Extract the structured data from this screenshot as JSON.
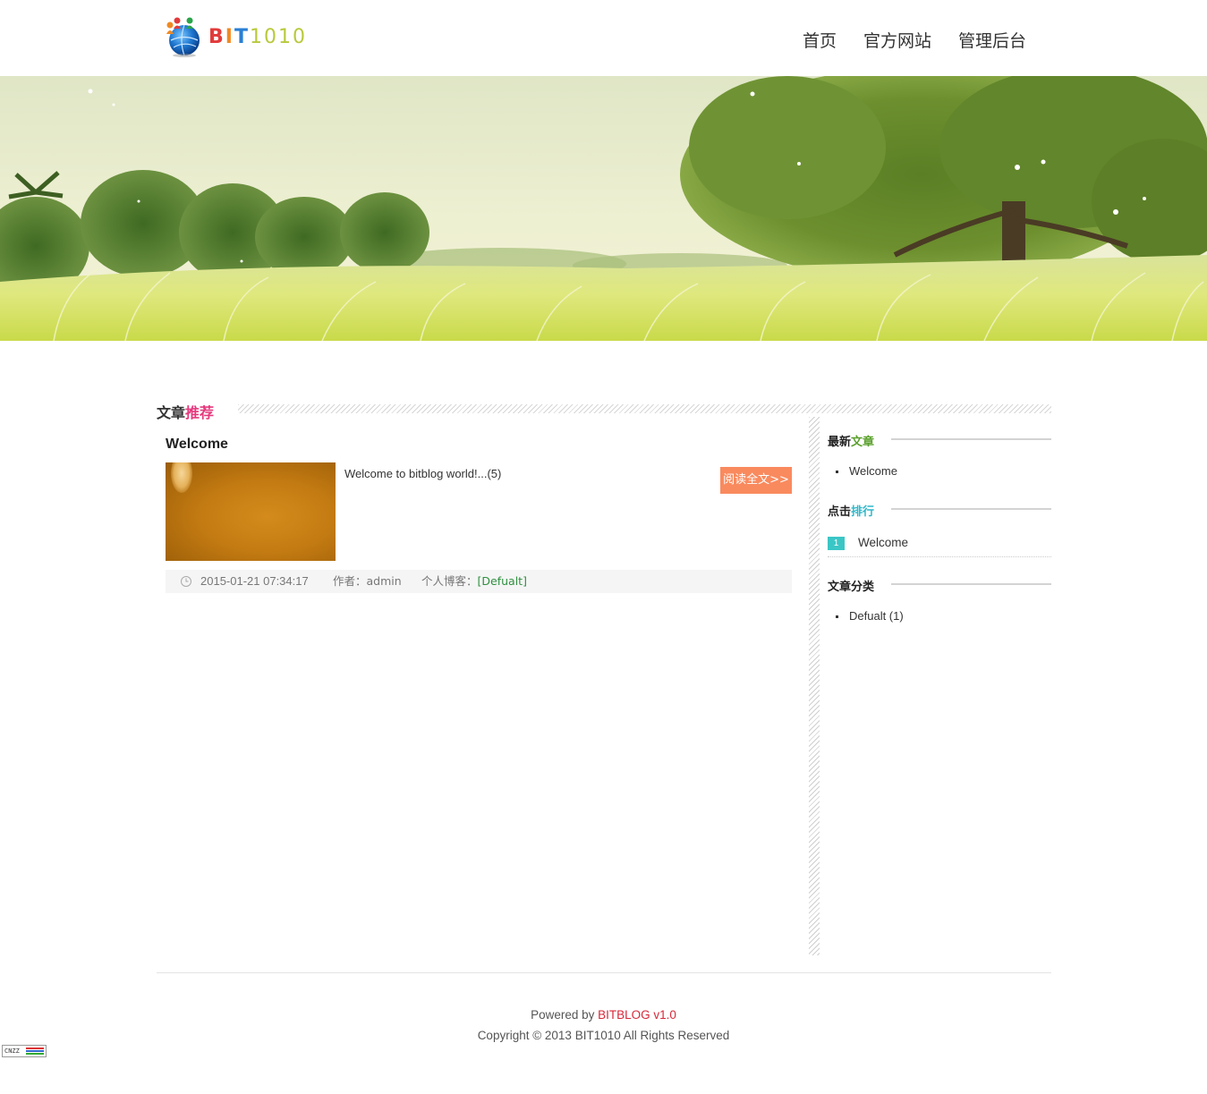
{
  "header": {
    "logo": {
      "brand_b": "B",
      "brand_i": "I",
      "brand_t": "T",
      "brand_num": "1010"
    },
    "nav": [
      {
        "label": "首页"
      },
      {
        "label": "官方网站"
      },
      {
        "label": "管理后台"
      }
    ]
  },
  "section": {
    "title_main": "文章",
    "title_highlight": "推荐",
    "highlight_color": "#e5397d"
  },
  "article": {
    "title": "Welcome",
    "summary": "Welcome to bitblog world!...(5)",
    "read_more": "阅读全文>>",
    "date": "2015-01-21 07:34:17",
    "author_label": "作者：admin",
    "blog_label": "个人博客：",
    "blog_category": "[Defualt]"
  },
  "sidebar": {
    "latest": {
      "title_main": "最新",
      "title_highlight": "文章",
      "highlight_color": "#5aa02c",
      "items": [
        "Welcome"
      ]
    },
    "ranking": {
      "title_main": "点击",
      "title_highlight": "排行",
      "highlight_color": "#2fb8c9",
      "items": [
        {
          "rank": "1",
          "title": "Welcome"
        }
      ]
    },
    "categories": {
      "title": "文章分类",
      "items": [
        "Defualt (1)"
      ]
    }
  },
  "footer": {
    "powered_prefix": "Powered by ",
    "powered_link": "BITBLOG v1.0",
    "copyright": "Copyright © 2013 BIT1010 All Rights Reserved"
  },
  "cnzz": {
    "label": "CNZZ"
  },
  "colors": {
    "accent_button": "#f98a5e",
    "link_green": "#2f8f3f",
    "link_red": "#d8283a",
    "rank_badge": "#3bc6c6"
  },
  "icons": [
    "globe-logo-icon",
    "clock-icon",
    "bullet-dot-icon"
  ]
}
